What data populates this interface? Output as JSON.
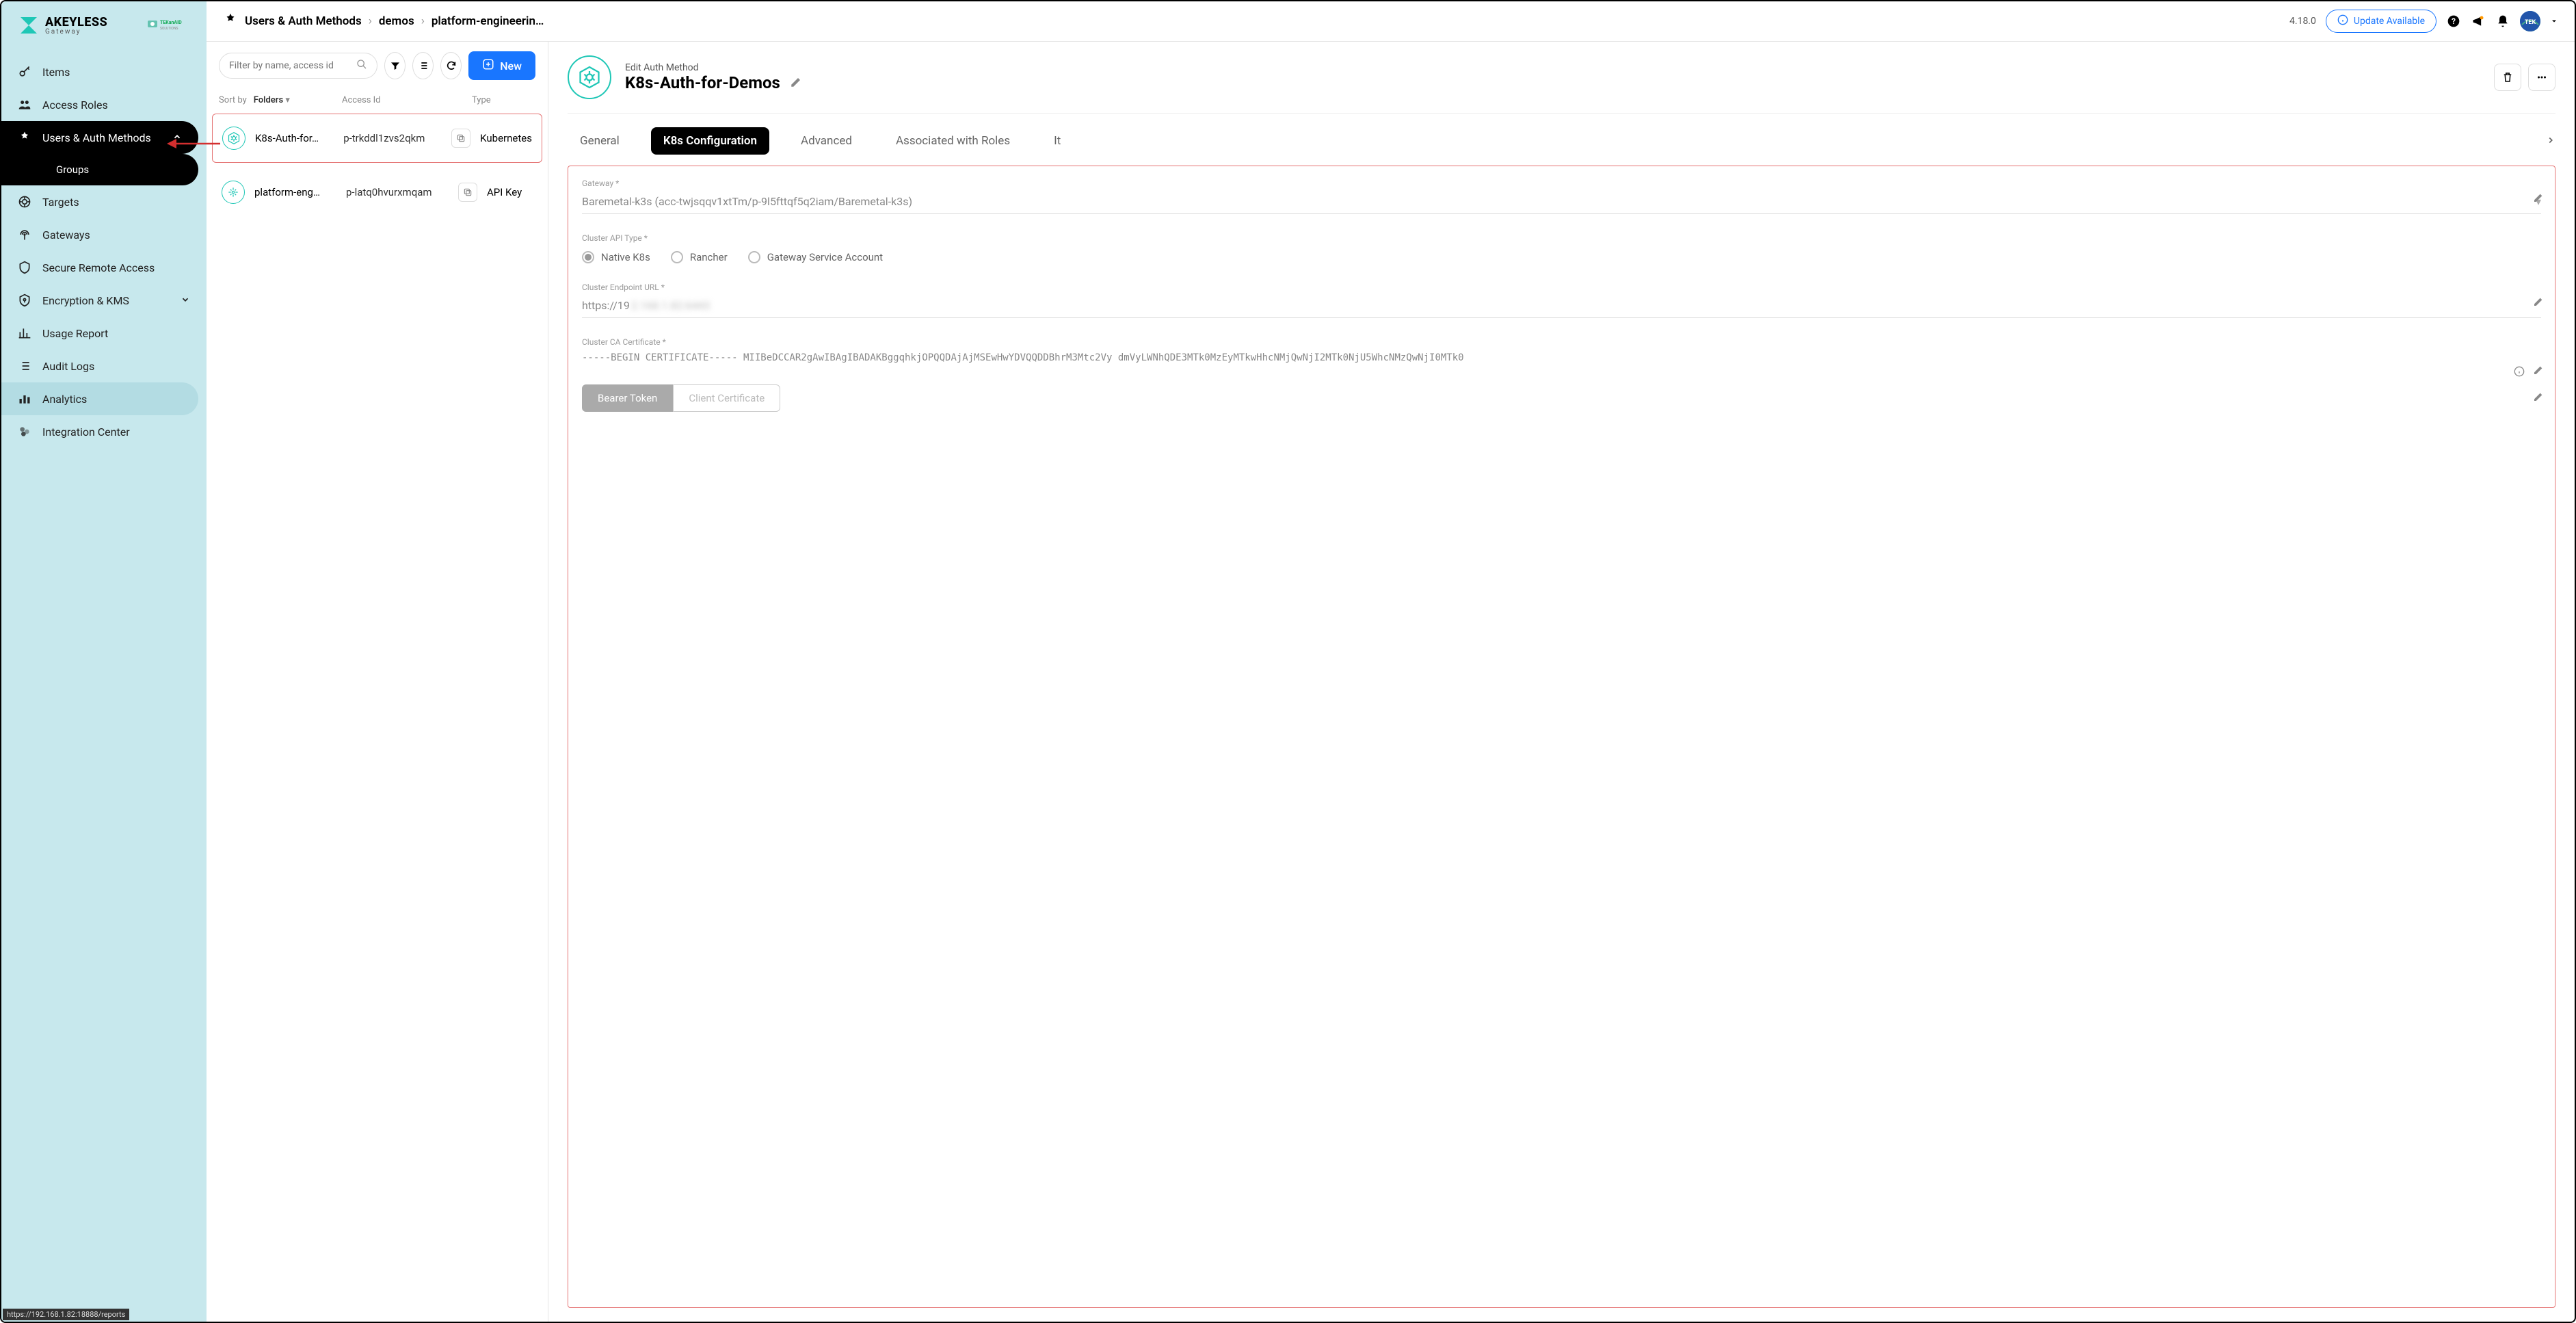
{
  "brand": {
    "name": "AKEYLESS",
    "sub": "Gateway",
    "partner": "TEKanAID"
  },
  "sidebar": {
    "items": [
      {
        "label": "Items"
      },
      {
        "label": "Access Roles"
      },
      {
        "label": "Users & Auth Methods"
      },
      {
        "label": "Groups"
      },
      {
        "label": "Targets"
      },
      {
        "label": "Gateways"
      },
      {
        "label": "Secure Remote Access"
      },
      {
        "label": "Encryption & KMS"
      },
      {
        "label": "Usage Report"
      },
      {
        "label": "Audit Logs"
      },
      {
        "label": "Analytics"
      },
      {
        "label": "Integration Center"
      }
    ]
  },
  "breadcrumb": {
    "root": "Users & Auth Methods",
    "p1": "demos",
    "p2": "platform-engineerin…"
  },
  "topbar": {
    "version": "4.18.0",
    "update": "Update Available"
  },
  "list": {
    "search_placeholder": "Filter by name, access id",
    "new_label": "New",
    "sort_label": "Sort by",
    "sort_value": "Folders",
    "col_access": "Access Id",
    "col_type": "Type",
    "rows": [
      {
        "name": "K8s-Auth-for…",
        "access": "p-trkddl1zvs2qkm",
        "type": "Kubernetes"
      },
      {
        "name": "platform-eng…",
        "access": "p-latq0hvurxmqam",
        "type": "API Key"
      }
    ]
  },
  "detail": {
    "sub": "Edit Auth Method",
    "title": "K8s-Auth-for-Demos",
    "tabs": {
      "general": "General",
      "k8s": "K8s Configuration",
      "advanced": "Advanced",
      "roles": "Associated with Roles",
      "more": "It"
    },
    "gateway_label": "Gateway *",
    "gateway_value": "Baremetal-k3s (acc-twjsqqv1xtTm/p-9l5fttqf5q2iam/Baremetal-k3s)",
    "api_type_label": "Cluster API Type *",
    "api_opts": {
      "native": "Native K8s",
      "rancher": "Rancher",
      "gsa": "Gateway Service Account"
    },
    "endpoint_label": "Cluster Endpoint URL *",
    "endpoint_value": "https://19",
    "ca_label": "Cluster CA Certificate *",
    "ca_value": "-----BEGIN CERTIFICATE-----\nMIIBeDCCAR2gAwIBAgIBADAKBggqhkjOPQQDAjAjMSEwHwYDVQQDDBhrM3Mtc2Vy\ndmVyLWNhQDE3MTk0MzEyMTkwHhcNMjQwNjI2MTk0NjU5WhcNMzQwNjI0MTk0",
    "auth_toggle": {
      "bearer": "Bearer Token",
      "cert": "Client Certificate"
    }
  },
  "status_url": "https://192.168.1.82:18888/reports"
}
